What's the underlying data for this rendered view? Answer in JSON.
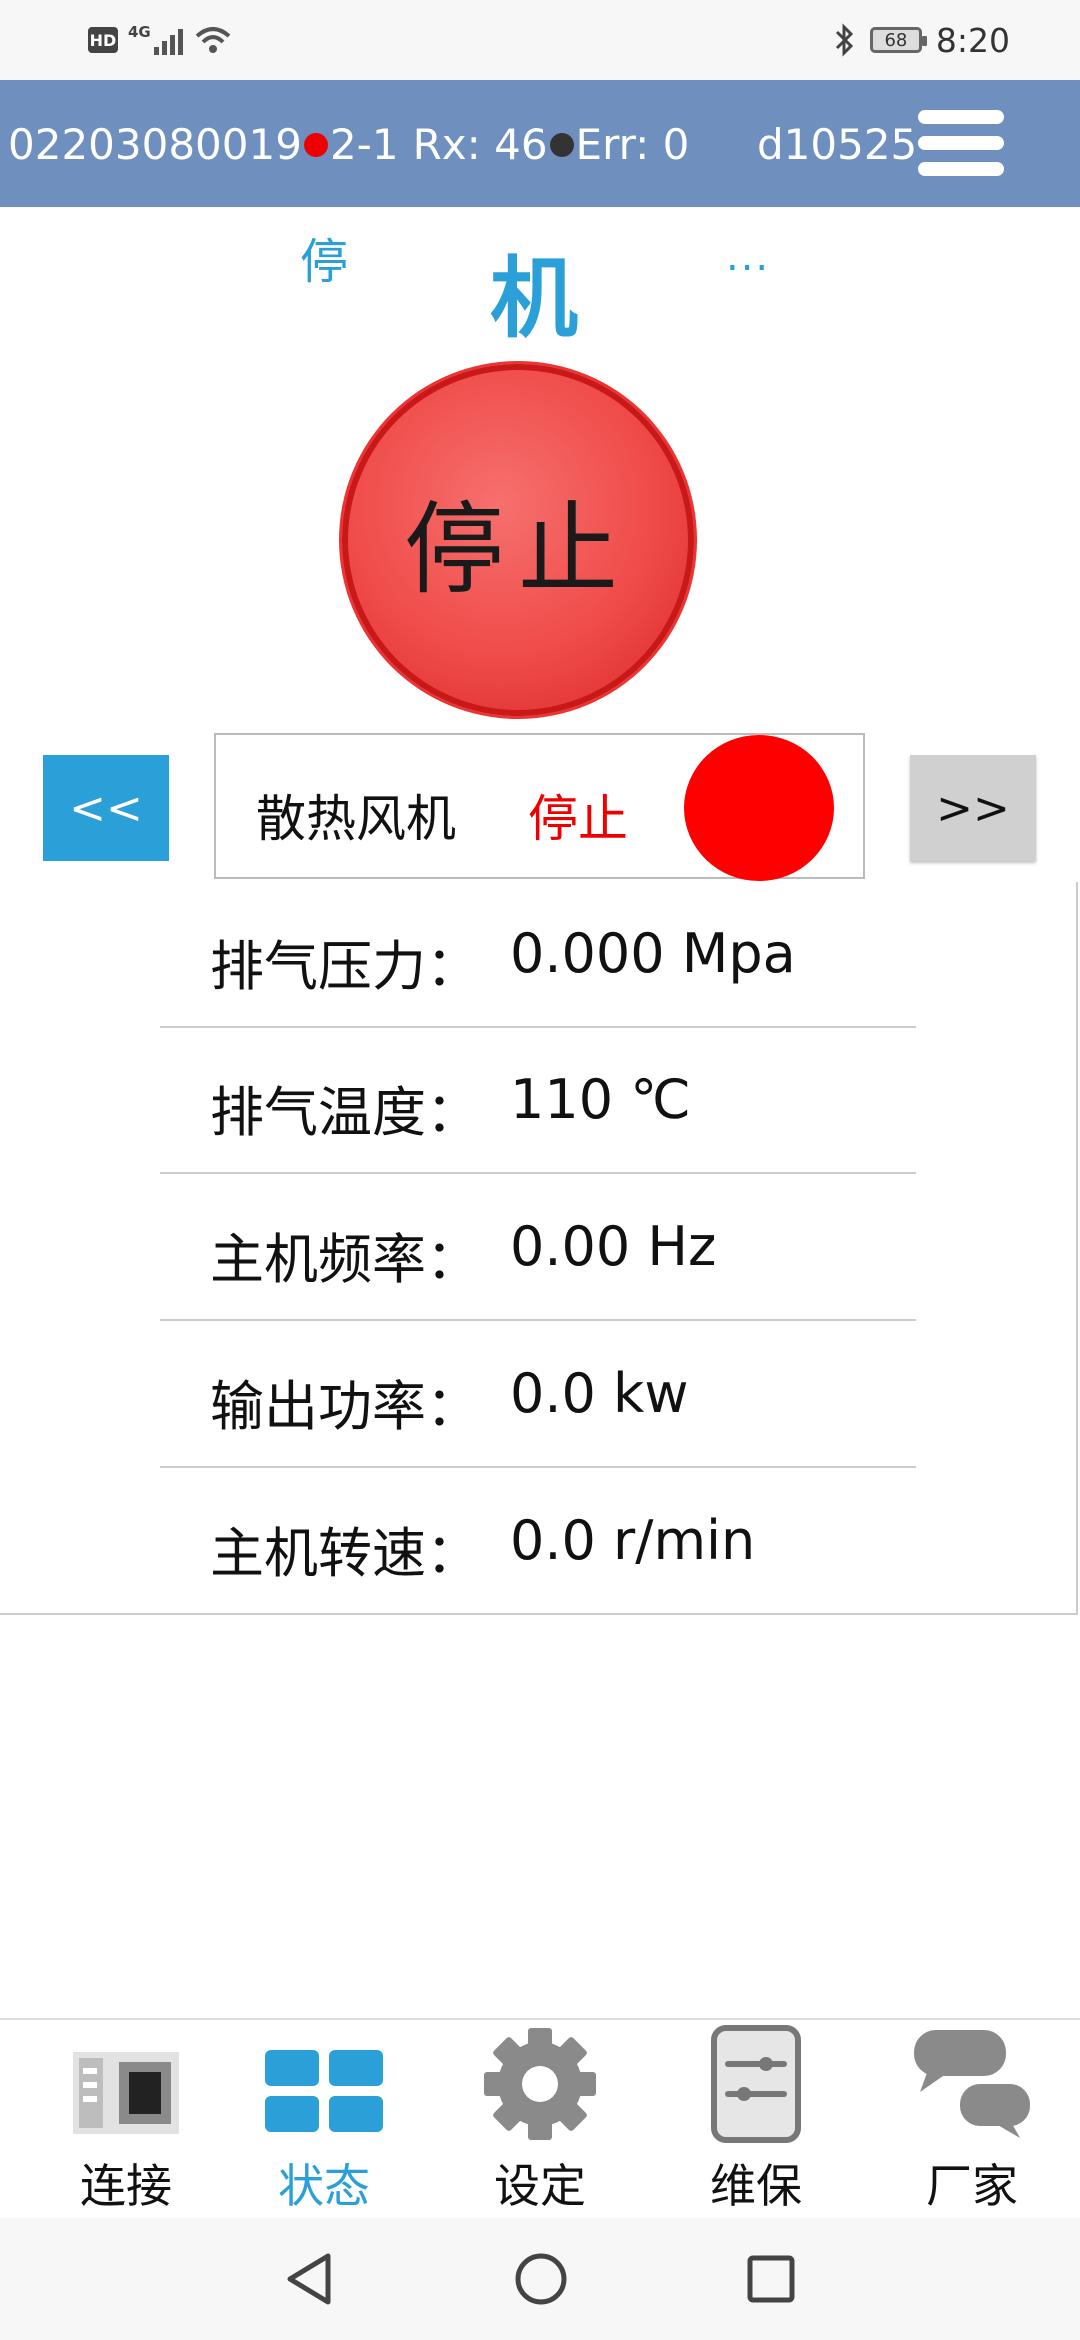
{
  "status_bar": {
    "hd": "HD",
    "network": "4G",
    "battery": "68",
    "time": "8:20"
  },
  "header": {
    "serial": "02203080019",
    "link": "2-1",
    "rx": "Rx: 46",
    "err": "Err: 0",
    "device_id": "d10525"
  },
  "title": {
    "left": "停",
    "center": "机",
    "right": "..."
  },
  "stop_button": {
    "label": "停止"
  },
  "component": {
    "prev_label": "<<",
    "next_label": ">>",
    "name": "散热风机",
    "state": "停止",
    "lamp_color": "#ff0000"
  },
  "readings": [
    {
      "label": "排气压力：",
      "value": "0.000 Mpa"
    },
    {
      "label": "排气温度：",
      "value": "110 ℃"
    },
    {
      "label": "主机频率：",
      "value": "0.00 Hz"
    },
    {
      "label": "输出功率：",
      "value": "0.0 kw"
    },
    {
      "label": "主机转速：",
      "value": "0.0 r/min"
    }
  ],
  "tabs": [
    {
      "label": "连接",
      "icon": "connect-icon"
    },
    {
      "label": "状态",
      "icon": "grid-icon",
      "active": true
    },
    {
      "label": "设定",
      "icon": "gear-icon"
    },
    {
      "label": "维保",
      "icon": "sliders-icon"
    },
    {
      "label": "厂家",
      "icon": "chat-icon"
    }
  ],
  "colors": {
    "header_bg": "#6f8fbf",
    "accent": "#2a9fd8",
    "stop_red": "#ef4a48"
  }
}
